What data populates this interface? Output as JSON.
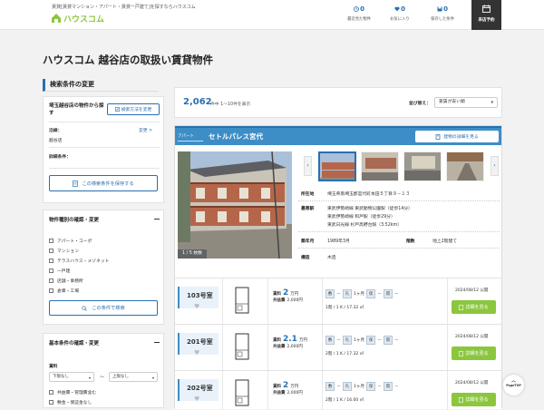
{
  "header": {
    "tagline": "賃貸[賃貸マンション・アパート・賃貸一戸建て]を探すならハウスコム",
    "logo_text": "ハウスコム",
    "recently_viewed": {
      "count": "0",
      "label": "最近見た物件"
    },
    "favorites": {
      "count": "0",
      "label": "お気に入り"
    },
    "saved_conditions": {
      "count": "0",
      "label": "保存した条件"
    },
    "store_visit": "来店予約"
  },
  "page_title": "ハウスコム 越谷店の取扱い賃貸物件",
  "sidebar": {
    "search_change_title": "検索条件の変更",
    "search_box": {
      "title": "埼玉越谷店の物件から探す",
      "method_button": "検索方法を変更",
      "route_label": "沿線：",
      "route_change": "変更 >",
      "route_value": "越谷店",
      "detail_label": "詳細条件：",
      "save_button": "この検索条件を保存する"
    },
    "types": {
      "title": "物件種別の確認・変更",
      "items": [
        "アパート・コーポ",
        "マンション",
        "テラスハウス・メゾネット",
        "一戸建",
        "店舗・事務所",
        "倉庫・工場"
      ],
      "submit": "この条件で検索"
    },
    "basic": {
      "title": "基本条件の確認・変更",
      "rent_label": "賃料",
      "rent_min": "下限なし",
      "rent_max": "上限なし",
      "tilde": "〜",
      "options": [
        "共益費・管理費含む",
        "敷金・保証金なし"
      ]
    }
  },
  "results": {
    "count": "2,062",
    "count_suffix": "件中 1～10件を表示",
    "sort_label": "並び替え：",
    "sort_value": "家賃が安い順"
  },
  "property": {
    "type_tag": "アパート",
    "name": "セトルパレス宮代",
    "detail_button": "建物の詳細を見る",
    "photo_count": "1 / 5 枚数",
    "address_label": "所在地",
    "address": "埼玉県南埼玉郡宮代町本田５丁目９－１３",
    "station_label": "最寄駅",
    "stations": [
      "東武伊勢崎線 東武動物公園駅（徒歩14分）",
      "東武伊勢崎線 和戸駅（徒歩29分）",
      "東武日光線 杉戸高野台駅（3.52km）"
    ],
    "built_label": "築年月",
    "built": "1989年3月",
    "floors_label": "階数",
    "floors": "地上2階建て",
    "structure_label": "構造",
    "structure": "木造"
  },
  "rooms": [
    {
      "number": "103号室",
      "rent": "2",
      "rent_unit": "万円",
      "common_fee": "2,000円",
      "deposit_label": "敷",
      "deposit": "－",
      "key_label": "礼",
      "key": "1ヶ月",
      "guarantee_label": "保",
      "guarantee": "－",
      "amort_label": "償",
      "amort": "－",
      "layout": "1階 / 1 K / 17.32 ㎡",
      "published": "2024/08/12 公開",
      "button": "詳細を見る"
    },
    {
      "number": "201号室",
      "rent": "2.1",
      "rent_unit": "万円",
      "common_fee": "2,000円",
      "deposit_label": "敷",
      "deposit": "－",
      "key_label": "礼",
      "key": "1ヶ月",
      "guarantee_label": "保",
      "guarantee": "－",
      "amort_label": "償",
      "amort": "－",
      "layout": "2階 / 1 K / 17.32 ㎡",
      "published": "2024/08/12 公開",
      "button": "詳細を見る"
    },
    {
      "number": "202号室",
      "rent": "2",
      "rent_unit": "万円",
      "common_fee": "2,000円",
      "deposit_label": "敷",
      "deposit": "－",
      "key_label": "礼",
      "key": "1ヶ月",
      "guarantee_label": "保",
      "guarantee": "－",
      "amort_label": "償",
      "amort": "－",
      "layout": "2階 / 1 K / 16.00 ㎡",
      "published": "2024/08/12 公開",
      "button": "詳細を見る"
    }
  ],
  "room_labels": {
    "rent": "賃料",
    "common": "共益費"
  },
  "pagetop": "PageTOP",
  "colors": {
    "brand_green": "#8cc63f",
    "accent_blue": "#2a6fb0",
    "header_bar": "#3d8ec7"
  }
}
